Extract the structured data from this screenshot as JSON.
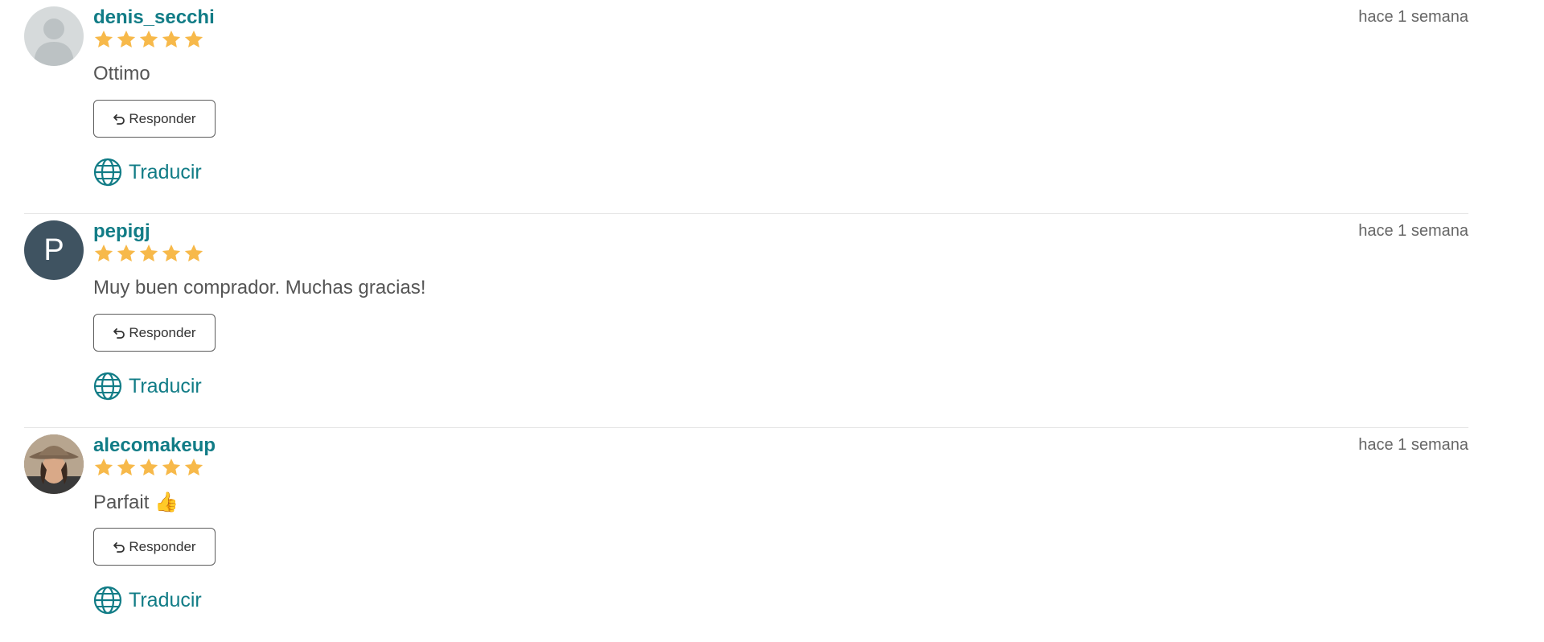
{
  "theme": {
    "username_color": "#117c86",
    "star_color": "#f7b94a",
    "letter_avatar_bg": "#3f5361"
  },
  "reviews": [
    {
      "username": "denis_secchi",
      "date": "hace 1 semana",
      "rating": 5,
      "comment": "Ottimo",
      "avatar": {
        "type": "default-silhouette",
        "icon": "user-silhouette-icon"
      },
      "reply_label": "Responder",
      "translate_label": "Traducir"
    },
    {
      "username": "pepigj",
      "date": "hace 1 semana",
      "rating": 5,
      "comment": "Muy buen comprador. Muchas gracias!",
      "avatar": {
        "type": "letter",
        "letter": "P"
      },
      "reply_label": "Responder",
      "translate_label": "Traducir"
    },
    {
      "username": "alecomakeup",
      "date": "hace 1 semana",
      "rating": 5,
      "comment": "Parfait 👍",
      "avatar": {
        "type": "photo",
        "icon": "user-photo"
      },
      "reply_label": "Responder",
      "translate_label": "Traducir"
    }
  ]
}
